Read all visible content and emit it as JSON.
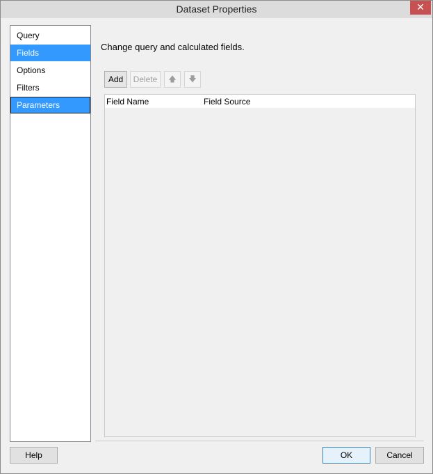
{
  "window": {
    "title": "Dataset Properties",
    "close_glyph": "✕"
  },
  "sidebar": {
    "items": [
      {
        "label": "Query"
      },
      {
        "label": "Fields"
      },
      {
        "label": "Options"
      },
      {
        "label": "Filters"
      },
      {
        "label": "Parameters"
      }
    ]
  },
  "main": {
    "header": "Change query and calculated fields.",
    "toolbar": {
      "add_label": "Add",
      "delete_label": "Delete",
      "move_up_glyph": "🡅",
      "move_down_glyph": "🡇"
    },
    "grid": {
      "columns": [
        "Field Name",
        "Field Source"
      ]
    }
  },
  "footer": {
    "help_label": "Help",
    "ok_label": "OK",
    "cancel_label": "Cancel"
  }
}
